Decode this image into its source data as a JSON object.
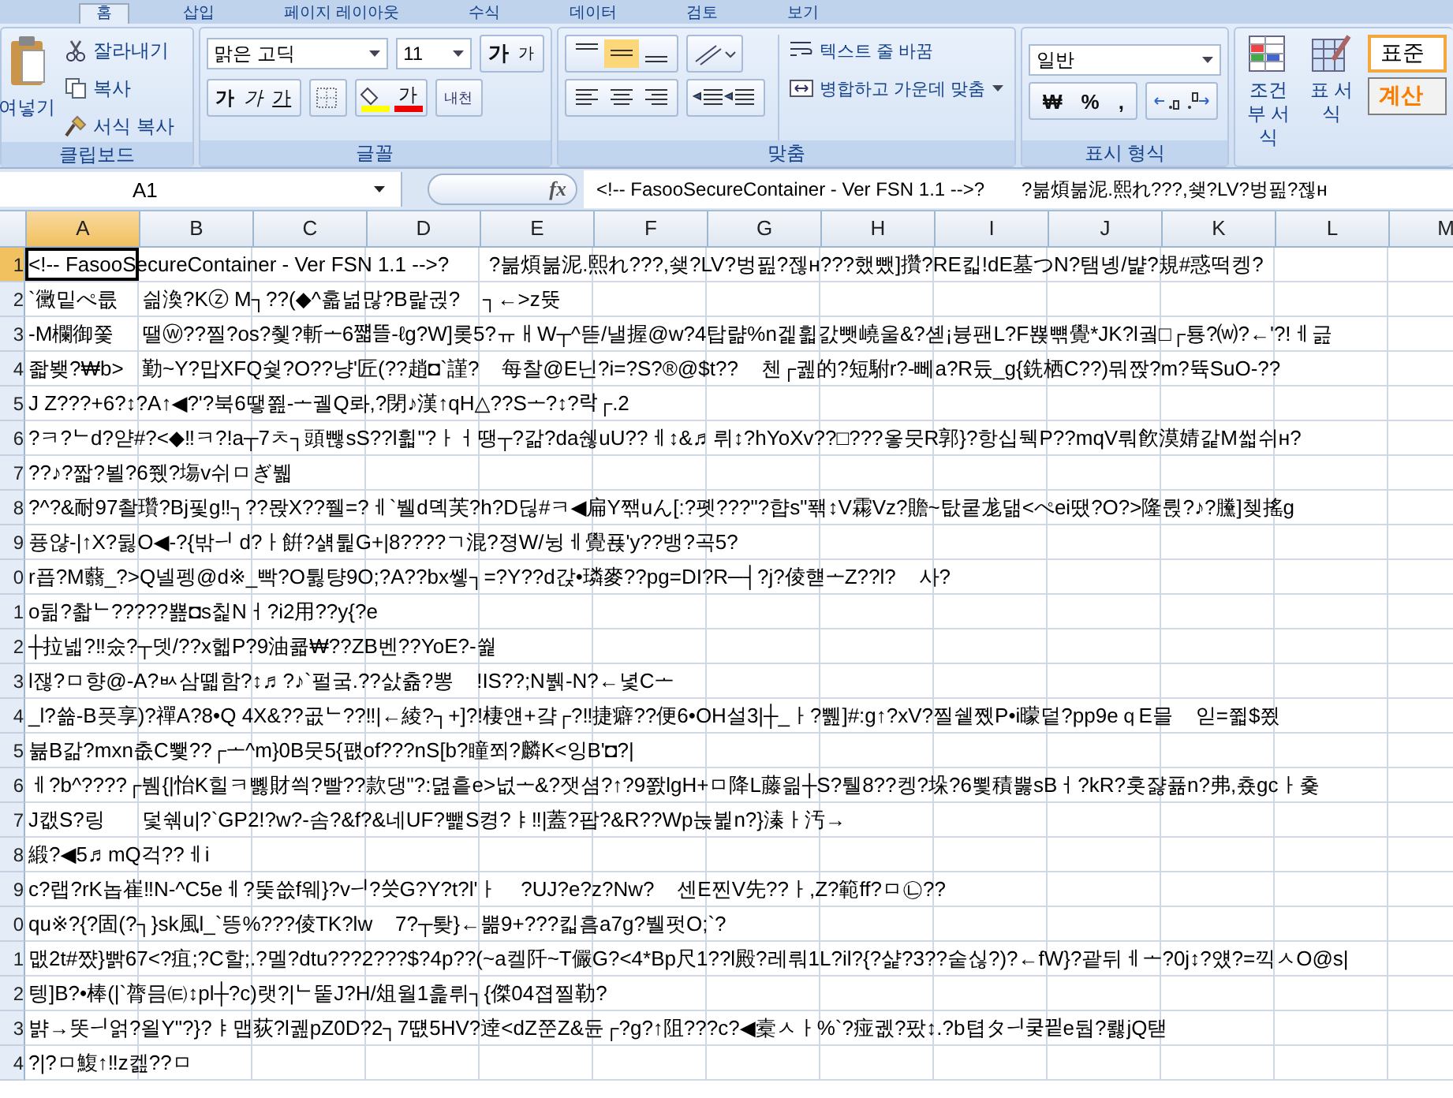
{
  "ribbon_tabs": [
    {
      "label": "홈",
      "selected": true
    },
    {
      "label": "삽입",
      "selected": false
    },
    {
      "label": "페이지 레이아웃",
      "selected": false
    },
    {
      "label": "수식",
      "selected": false
    },
    {
      "label": "데이터",
      "selected": false
    },
    {
      "label": "검토",
      "selected": false
    },
    {
      "label": "보기",
      "selected": false
    }
  ],
  "clipboard": {
    "paste": "여넣기",
    "cut": "잘라내기",
    "copy": "복사",
    "format_painter": "서식 복사",
    "group_label": "클립보드"
  },
  "font": {
    "font_name": "맑은 고딕",
    "font_size": "11",
    "grow": "가",
    "shrink": "가",
    "bold": "가",
    "italic": "가",
    "underline": "가",
    "font_color": "가",
    "phonetic": "내천",
    "group_label": "글꼴"
  },
  "alignment": {
    "wrap_text": "텍스트 줄 바꿈",
    "merge_center": "병합하고 가운데 맞춤",
    "group_label": "맞춤"
  },
  "number": {
    "format": "일반",
    "currency": "₩",
    "percent": "%",
    "comma": ",",
    "group_label": "표시 형식"
  },
  "styles": {
    "conditional": "조건부 서식",
    "table": "표 서식",
    "normal": "표준",
    "calculation": "계산"
  },
  "formula_bar": {
    "name_box": "A1",
    "fx": "fx",
    "content": "<!-- FasooSecureContainer - Ver FSN 1.1 -->?       ?붊煩붊泥.熙れ???,쇚?LV?벙핊?젢ʜ"
  },
  "sheet": {
    "columns": [
      {
        "label": "A",
        "selected": true
      },
      {
        "label": "B",
        "selected": false
      },
      {
        "label": "C",
        "selected": false
      },
      {
        "label": "D",
        "selected": false
      },
      {
        "label": "E",
        "selected": false
      },
      {
        "label": "F",
        "selected": false
      },
      {
        "label": "G",
        "selected": false
      },
      {
        "label": "H",
        "selected": false
      },
      {
        "label": "I",
        "selected": false
      },
      {
        "label": "J",
        "selected": false
      },
      {
        "label": "K",
        "selected": false
      },
      {
        "label": "L",
        "selected": false
      },
      {
        "label": "M",
        "selected": false
      }
    ],
    "rows": [
      {
        "number": "1",
        "selected": true,
        "cells": [
          "<!-- FasooSecureContainer - Ver FSN 1.1 -->?       ?붊煩붊泥.熙れ???,쇚?LV?벙핊?젢ʜ???했뺐]攢?RE킯!dE墓つN?탬녱/뱙?規#惑떡켕?"
        ]
      },
      {
        "number": "2",
        "selected": false,
        "cells": [
          "`黴밑ぺ릆",
          "싊渙?Kⓩ M┐??(◆^홃넒많?B랉귅?    ┐←>z뜟"
        ]
      },
      {
        "number": "3",
        "selected": false,
        "cells": [
          "-M欄御쫓",
          "땔ⓦ??찔?os?췣?斬ᅩ6쨻뜰-ℓg?W]롲5?ㅠㅐW┬^뜯/낼握@w?4탑랾%n겙휣갌뺏嶢울&?셷¡븅팬L?F뾵뺶覺*JK?l궠□┌툥?⒲?←'?!ㅔ긆"
        ]
      },
      {
        "number": "4",
        "selected": false,
        "cells": [
          "좗뵂?₩b>",
          "勤~Y?맙XFQ쉋?O??냥'匠(??趙◘`謹?    每찰@E닌?i=?S?®@$t??    첸┌궲的?短駙r?-뻬a?R듔_g{銑栖C??)뭐짡?m?뜍SuO-??"
        ]
      },
      {
        "number": "5",
        "selected": false,
        "cells": [
          "J Z???+6?↕?A↑◀?'?북6땧쬞-ᅩ궬Q롸,?閉♪漢↑qH△??Sᅩ?↕?락┌.2"
        ]
      },
      {
        "number": "6",
        "selected": false,
        "cells": [
          "?ㅋ?ᄂd?얃#?<◆‼ㅋ?!a┬7ㅊ┐頭뺂sS??l휣\"?ㅏㅓ땡┬?갊?da쉖uU??ㅔ↕&♬뤼↕?hYoXv??□???옿뭇R郭}?항십뒉P??mqV뤄飮漠婧갍M썳쉬ʜ?"
        ]
      },
      {
        "number": "7",
        "selected": false,
        "cells": [
          "??♪?짧?뵐?6쮔?塲v쉬ㅁぎ뷃"
        ]
      },
      {
        "number": "8",
        "selected": false,
        "cells": [
          "?^?&耐97촬瓚?Bj핓g‼┐??뫉X??쮈=?ㅔ`뷀d뎩芙?h?D딚#ㅋ◀扁Y짺uん[:?폣???\"?햡s\"퐦↕V霦Vz?贍~탒쿹尨댊<ぺei땠?O?>隆륁?♪?黱]쳊搖g"
        ]
      },
      {
        "number": "9",
        "selected": false,
        "cells": [
          "퓽얂-|↑X?뒳O◀-?{밖ᅴ d?ㅏ餠?섉튍G+|8????ㄱ混?졍W/뉭ㅔ覺푡'y??뱅?곡5?"
        ]
      },
      {
        "number": "0",
        "selected": false,
        "cells": [
          "r픕?M蘙_?>Q넬펭@d※_빡?O튏턍9O;?A??bx쏗┐=?Y??d갅•璘麥??pg=DI?R─┤?j?倰햳ᅩZ??l?    사?"
        ]
      },
      {
        "number": "1",
        "selected": false,
        "cells": [
          "o뒮?촯ᄂ?????뾾◘s칥Nㅓ?i2用??y{?e"
        ]
      },
      {
        "number": "2",
        "selected": false,
        "cells": [
          "┼拉넯?‼숬?┬뎃/??x헯P?9油쿏₩??ZB벤??YoE?-쒍"
        ]
      },
      {
        "number": "3",
        "selected": false,
        "cells": [
          "l잲?ㅁ향@-A?ㅄ삼뗿함?↕♬?♪`펄궄.??삸츎?뽕    !IS??;N뷁-N?←녗Cᅩ"
        ]
      },
      {
        "number": "4",
        "selected": false,
        "cells": [
          "_l?쑒-B픗享)?禪A?8•Q 4X&??곲ᄂ??‼|←綾?┐+]?!棲얜+걐┌?‼捷癖??便6•OH설3|┼_ㅏ?쀒]#:g↑?xV?찔쉩쪴P•i曚덭?pp9eｑE믈    읻=쮧$쬤"
        ]
      },
      {
        "number": "5",
        "selected": false,
        "cells": [
          "뷺B갊?mxn춦C뾏??┌ᅩ^m}0B뭇5{퍲of???nS[b?瞳쬐?麟K<잉B'◘?|"
        ]
      },
      {
        "number": "6",
        "selected": false,
        "cells": [
          "ㅔ?b^????┌뷈{|怡K힐ㅋ뼳財씍?빨??款댕\"?:뎚흩e>넚ᅩ&?잿셤?↑?9쫤lgH+ㅁ降L藤읢┼S?퉬8??켕?垛?6뾫積뿛sBㅓ?kR?홋쟗퓲n?弗,춌gcㅏ춏"
        ]
      },
      {
        "number": "7",
        "selected": false,
        "cells": [
          "J캢S?링",
          "덫쉒u|?`GP2!?w?-솜?&f?&네UF?뺉S켱?ㅑ‼|蓋?팝?&R??Wp눉뷡n?}溱ㅏ汚→"
        ]
      },
      {
        "number": "8",
        "selected": false,
        "cells": [
          "緞?◀5♬mQ걱??ㅔi"
        ]
      },
      {
        "number": "9",
        "selected": false,
        "cells": [
          "c?랩?rK놉崔‼N-^C5eㅔ?뚲씂f웨}?vᅴ?씃G?Y?t?l'ㅏ    ?UJ?e?z?Nw?    센E찐V先??ㅏ,Z?範ff?ㅁ㉡??"
        ]
      },
      {
        "number": "0",
        "selected": false,
        "cells": [
          "qu※?{?固(?┐}sk風l_`뜽%???倰TK?lw    7?┬퇒}←뿖9+???킯흠a7g?뷀펏O;`?"
        ]
      },
      {
        "number": "1",
        "selected": false,
        "cells": [
          "맶2t#쨨}빩67<?疽;?C할;.?멜?dtu???2???$?4p??(~a켈阡~T儼G?<4*Bp尺1??l殿?레뤄1L?il?{?샱?3??숱싢?)?←fW}?괕뒤ㅔᅩ?0j↕?얬?=끽ㅅO@s|"
        ]
      },
      {
        "number": "2",
        "selected": false,
        "cells": [
          "텡]B?•棒(|`膂믐㈋↕pl┼?c)랫?|ᄂ뚵J?H/俎월1흝뤼┐{傑04졉찔勒?"
        ]
      },
      {
        "number": "3",
        "selected": false,
        "cells": [
          "뱕→똣ᅴ얽?욀Y\"?}?ㅑ맵荻?l궲pZ0D?2┐7떖5HV?逹<dZ쭌Z&듄┌?g?↑阻???c?◀槖ㅅㅏ%`?痖궶?팠↕.?b텹タᅴ쿶끹e둽?뢣jQ탣"
        ]
      },
      {
        "number": "4",
        "selected": false,
        "cells": [
          "?|?ㅁ鰒↑‼z켎??ㅁ"
        ]
      }
    ]
  }
}
